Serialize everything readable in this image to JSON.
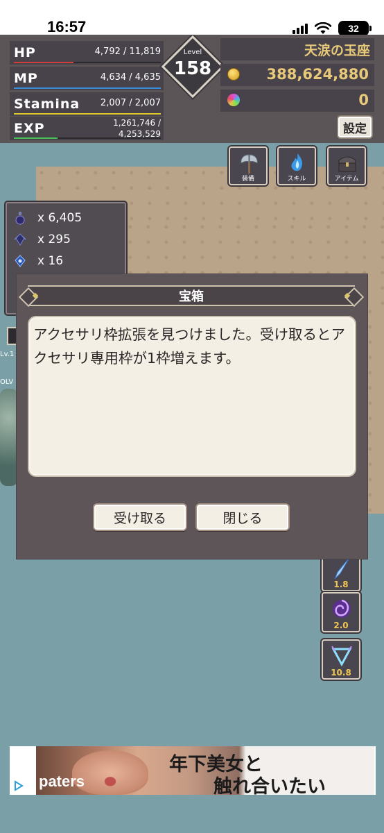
{
  "status_bar": {
    "time": "16:57",
    "battery": "32"
  },
  "hud": {
    "stats": [
      {
        "label": "HP",
        "value": "4,792 / 11,819",
        "fill": 0.405,
        "color": "#d43b3b"
      },
      {
        "label": "MP",
        "value": "4,634 / 4,635",
        "fill": 0.999,
        "color": "#3a8fd8"
      },
      {
        "label": "Stamina",
        "value": "2,007 / 2,007",
        "fill": 1.0,
        "color": "#e0c930"
      },
      {
        "label": "EXP",
        "value_line1": "1,261,746 /",
        "value_line2": "4,253,529",
        "fill": 0.297,
        "color": "#47c05a"
      }
    ],
    "level_label": "Level",
    "level": "158",
    "location": "天涙の玉座",
    "gold": "388,624,880",
    "gems": "0",
    "settings_label": "設定"
  },
  "menu": [
    {
      "label": "装備",
      "icon": "battle-axe-icon"
    },
    {
      "label": "スキル",
      "icon": "blue-flame-icon"
    },
    {
      "label": "アイテム",
      "icon": "treasure-chest-icon"
    }
  ],
  "inventory": [
    {
      "icon": "potion-icon",
      "count": "x 6,405"
    },
    {
      "icon": "dark-crystal-icon",
      "count": "x 295"
    },
    {
      "icon": "blue-crystal-icon",
      "count": "x 16"
    }
  ],
  "skill_slots": [
    {
      "icon": "ice-shard-icon",
      "value": "1.8"
    },
    {
      "icon": "purple-vortex-icon",
      "value": "2.0"
    },
    {
      "icon": "triangle-rune-icon",
      "value": "10.8"
    }
  ],
  "left_edge": {
    "level_text": "Lv.1",
    "name_text": "OLV"
  },
  "modal": {
    "title": "宝箱",
    "message": "アクセサリ枠拡張を見つけました。受け取るとアクセサリ専用枠が1枠増えます。",
    "accept_label": "受け取る",
    "close_label": "閉じる"
  },
  "ad": {
    "brand": "paters",
    "headline_line1": "年下美女と",
    "headline_line2": "触れ合いたい"
  }
}
